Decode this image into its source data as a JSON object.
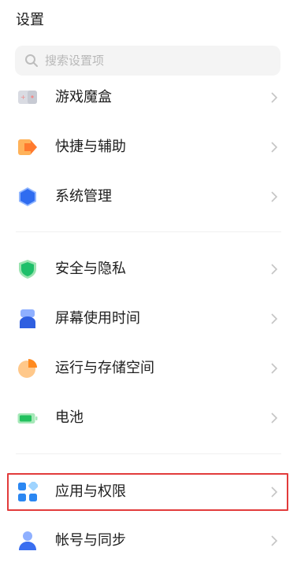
{
  "header": {
    "title": "设置"
  },
  "search": {
    "placeholder": "搜索设置项",
    "icon": "search-icon"
  },
  "colors": {
    "highlight_border": "#e23b3b",
    "chevron": "#c4c4c4"
  },
  "settings": {
    "items": [
      {
        "label": "游戏魔盒",
        "icon": "game-box-icon"
      },
      {
        "label": "快捷与辅助",
        "icon": "shortcut-icon"
      },
      {
        "label": "系统管理",
        "icon": "system-hexagon-icon"
      },
      {
        "label": "安全与隐私",
        "icon": "shield-icon"
      },
      {
        "label": "屏幕使用时间",
        "icon": "screen-time-icon"
      },
      {
        "label": "运行与存储空间",
        "icon": "pie-chart-icon"
      },
      {
        "label": "电池",
        "icon": "battery-icon"
      },
      {
        "label": "应用与权限",
        "icon": "apps-grid-icon",
        "highlighted": true
      },
      {
        "label": "帐号与同步",
        "icon": "person-icon"
      }
    ]
  }
}
